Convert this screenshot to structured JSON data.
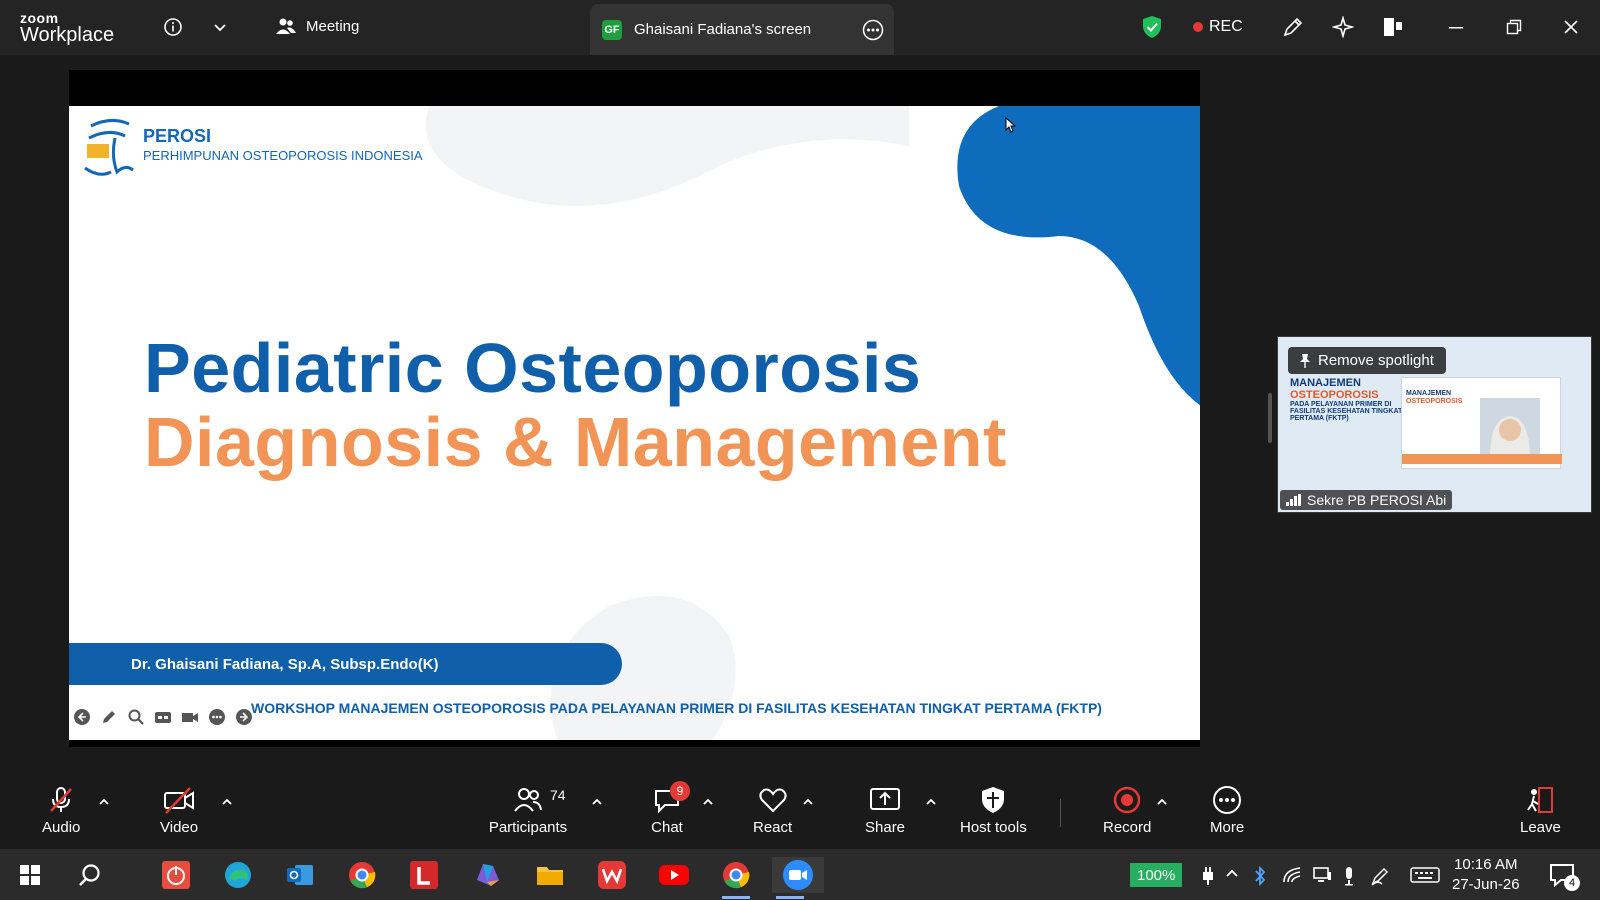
{
  "titlebar": {
    "brand_top": "zoom",
    "brand_bottom": "Workplace",
    "meeting_label": "Meeting",
    "screen_tab_initials": "GF",
    "screen_tab_label": "Ghaisani Fadiana's screen",
    "rec_label": "REC"
  },
  "slide": {
    "org_name": "PEROSI",
    "org_full": "PERHIMPUNAN OSTEOPOROSIS INDONESIA",
    "title_line1": "Pediatric Osteoporosis",
    "title_line2": "Diagnosis & Management",
    "presenter": "Dr. Ghaisani Fadiana, Sp.A, Subsp.Endo(K)",
    "workshop": "WORKSHOP MANAJEMEN OSTEOPOROSIS PADA PELAYANAN PRIMER DI FASILITAS KESEHATAN TINGKAT PERTAMA (FKTP)"
  },
  "thumbnail": {
    "spotlight_label": "Remove spotlight",
    "participant_name": "Sekre PB PEROSI Abi",
    "poster_line1": "MANAJEMEN",
    "poster_line2": "OSTEOPOROSIS",
    "poster_line3": "PADA PELAYANAN PRIMER DI FASILITAS KESEHATAN TINGKAT PERTAMA (FKTP)",
    "inner_line1": "MANAJEMEN",
    "inner_line2": "OSTEOPOROSIS"
  },
  "controls": {
    "audio": "Audio",
    "video": "Video",
    "participants": "Participants",
    "participants_count": "74",
    "chat": "Chat",
    "chat_badge": "9",
    "react": "React",
    "share": "Share",
    "host_tools": "Host tools",
    "record": "Record",
    "more": "More",
    "leave": "Leave"
  },
  "taskbar": {
    "battery": "100%",
    "time": "10:16 AM",
    "date": "27-Jun-26",
    "notifications": "4"
  },
  "colors": {
    "slide_blue": "#0f5fab",
    "slide_orange": "#f39457",
    "rec_red": "#e53935",
    "shield_green": "#1fbf5a",
    "zoom_blue": "#2d8cff"
  }
}
